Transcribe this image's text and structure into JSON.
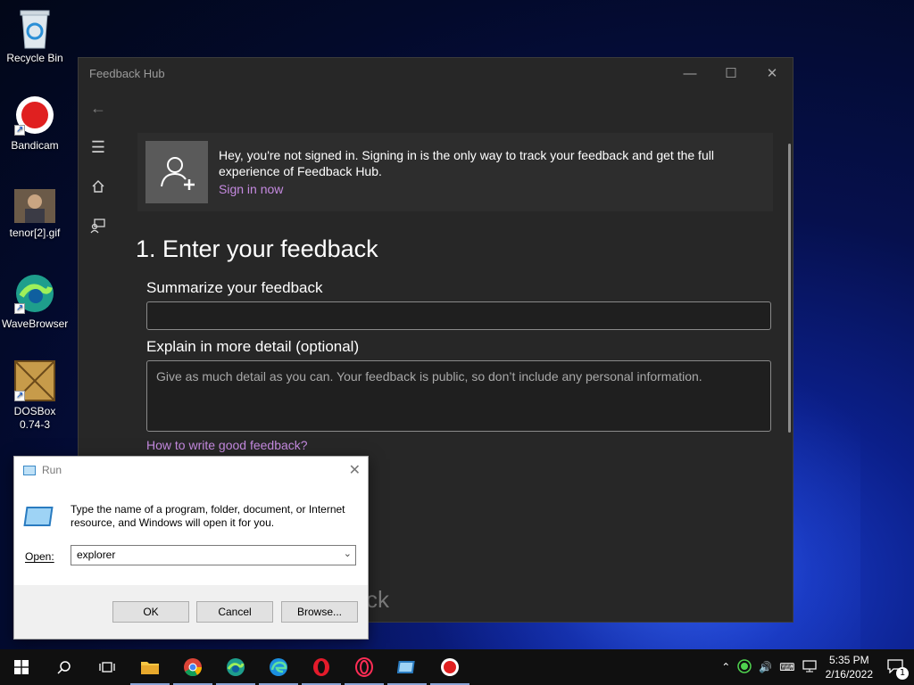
{
  "desktop": {
    "icons": [
      {
        "label": "Recycle Bin"
      },
      {
        "label": "Bandicam"
      },
      {
        "label": "tenor[2].gif"
      },
      {
        "label": "WaveBrowser"
      },
      {
        "label": "DOSBox 0.74-3"
      }
    ]
  },
  "feedback_hub": {
    "title": "Feedback Hub",
    "signin_message": "Hey, you're not signed in. Signing in is the only way to track your feedback and get the full experience of Feedback Hub.",
    "signin_link": "Sign in now",
    "section_title": "1. Enter your feedback",
    "summary_label": "Summarize your feedback",
    "summary_value": "",
    "detail_label": "Explain in more detail (optional)",
    "detail_placeholder": "Give as much detail as you can. Your feedback is public, so don’t include any personal information.",
    "help_link": "How to write good feedback?",
    "ghost_text": "ck"
  },
  "run_dialog": {
    "title": "Run",
    "description": "Type the name of a program, folder, document, or Internet resource, and Windows will open it for you.",
    "open_label": "Open:",
    "open_value": "explorer",
    "ok": "OK",
    "cancel": "Cancel",
    "browse": "Browse..."
  },
  "taskbar": {
    "time": "5:35 PM",
    "date": "2/16/2022",
    "notification_count": "1"
  },
  "colors": {
    "accent_link": "#c58ae0",
    "window_bg": "#272727",
    "taskbar_bg": "#101010"
  }
}
